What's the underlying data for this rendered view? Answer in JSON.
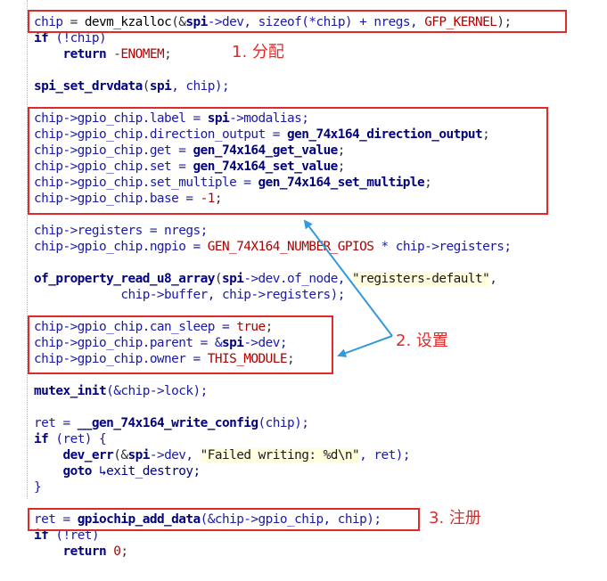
{
  "code_lines": [
    [
      {
        "t": "chip",
        "c": "var"
      },
      {
        "t": " = ",
        "c": "op"
      },
      {
        "t": "devm_kzalloc",
        "c": "plain"
      },
      {
        "t": "(&",
        "c": "op"
      },
      {
        "t": "spi",
        "c": "kw"
      },
      {
        "t": "->dev, sizeof(*chip) + nregs, ",
        "c": "var"
      },
      {
        "t": "GFP_KERNEL",
        "c": "macro"
      },
      {
        "t": ");",
        "c": "op"
      }
    ],
    [
      {
        "t": "if",
        "c": "kw"
      },
      {
        "t": " (!chip)",
        "c": "var"
      }
    ],
    [
      {
        "t": "    return",
        "c": "kw"
      },
      {
        "t": " -",
        "c": "op"
      },
      {
        "t": "ENOMEM",
        "c": "macro"
      },
      {
        "t": ";",
        "c": "op"
      }
    ],
    [],
    [
      {
        "t": "spi_set_drvdata",
        "c": "fn"
      },
      {
        "t": "(",
        "c": "op"
      },
      {
        "t": "spi",
        "c": "kw"
      },
      {
        "t": ", chip);",
        "c": "var"
      }
    ],
    [],
    [
      {
        "t": "chip->gpio_chip.label = ",
        "c": "var"
      },
      {
        "t": "spi",
        "c": "kw"
      },
      {
        "t": "->modalias;",
        "c": "var"
      }
    ],
    [
      {
        "t": "chip->gpio_chip.direction_output = ",
        "c": "var"
      },
      {
        "t": "gen_74x164_direction_output",
        "c": "fn"
      },
      {
        "t": ";",
        "c": "op"
      }
    ],
    [
      {
        "t": "chip->gpio_chip.get = ",
        "c": "var"
      },
      {
        "t": "gen_74x164_get_value",
        "c": "fn"
      },
      {
        "t": ";",
        "c": "op"
      }
    ],
    [
      {
        "t": "chip->gpio_chip.set = ",
        "c": "var"
      },
      {
        "t": "gen_74x164_set_value",
        "c": "fn"
      },
      {
        "t": ";",
        "c": "op"
      }
    ],
    [
      {
        "t": "chip->gpio_chip.set_multiple = ",
        "c": "var"
      },
      {
        "t": "gen_74x164_set_multiple",
        "c": "fn"
      },
      {
        "t": ";",
        "c": "op"
      }
    ],
    [
      {
        "t": "chip->gpio_chip.base = ",
        "c": "var"
      },
      {
        "t": "-1",
        "c": "num"
      },
      {
        "t": ";",
        "c": "op"
      }
    ],
    [],
    [
      {
        "t": "chip->registers = nregs;",
        "c": "var"
      }
    ],
    [
      {
        "t": "chip->gpio_chip.ngpio = ",
        "c": "var"
      },
      {
        "t": "GEN_74X164_NUMBER_GPIOS",
        "c": "macro"
      },
      {
        "t": " * chip->registers;",
        "c": "var"
      }
    ],
    [],
    [
      {
        "t": "of_property_read_u8_array",
        "c": "fn"
      },
      {
        "t": "(",
        "c": "op"
      },
      {
        "t": "spi",
        "c": "kw"
      },
      {
        "t": "->dev.of_node, ",
        "c": "var"
      },
      {
        "t": "\"registers-default\"",
        "c": "str"
      },
      {
        "t": ",",
        "c": "op"
      }
    ],
    [
      {
        "t": "            chip->buffer, chip->registers);",
        "c": "var"
      }
    ],
    [],
    [
      {
        "t": "chip->gpio_chip.can_sleep = ",
        "c": "var"
      },
      {
        "t": "true",
        "c": "bool"
      },
      {
        "t": ";",
        "c": "op"
      }
    ],
    [
      {
        "t": "chip->gpio_chip.parent = &",
        "c": "var"
      },
      {
        "t": "spi",
        "c": "kw"
      },
      {
        "t": "->dev;",
        "c": "var"
      }
    ],
    [
      {
        "t": "chip->gpio_chip.owner = ",
        "c": "var"
      },
      {
        "t": "THIS_MODULE",
        "c": "macro"
      },
      {
        "t": ";",
        "c": "op"
      }
    ],
    [],
    [
      {
        "t": "mutex_init",
        "c": "fn"
      },
      {
        "t": "(&chip->lock);",
        "c": "var"
      }
    ],
    [],
    [
      {
        "t": "ret = ",
        "c": "var"
      },
      {
        "t": "__gen_74x164_write_config",
        "c": "fn"
      },
      {
        "t": "(chip);",
        "c": "var"
      }
    ],
    [
      {
        "t": "if",
        "c": "kw"
      },
      {
        "t": " (ret) {",
        "c": "var"
      }
    ],
    [
      {
        "t": "    dev_err",
        "c": "fn"
      },
      {
        "t": "(&",
        "c": "op"
      },
      {
        "t": "spi",
        "c": "kw"
      },
      {
        "t": "->dev, ",
        "c": "var"
      },
      {
        "t": "\"Failed writing: %d\\n\"",
        "c": "str"
      },
      {
        "t": ", ret);",
        "c": "var"
      }
    ],
    [
      {
        "t": "    goto",
        "c": "kw"
      },
      {
        "t": " ↳exit_destroy;",
        "c": "label"
      }
    ],
    [
      {
        "t": "}",
        "c": "var"
      }
    ],
    [],
    [
      {
        "t": "ret = ",
        "c": "var"
      },
      {
        "t": "gpiochip_add_data",
        "c": "fn"
      },
      {
        "t": "(&chip->gpio_chip, chip);",
        "c": "var"
      }
    ],
    [
      {
        "t": "if",
        "c": "kw"
      },
      {
        "t": " (!ret)",
        "c": "var"
      }
    ],
    [
      {
        "t": "    return",
        "c": "kw"
      },
      {
        "t": " ",
        "c": "op"
      },
      {
        "t": "0",
        "c": "num"
      },
      {
        "t": ";",
        "c": "op"
      }
    ]
  ],
  "annotations": {
    "step1": "1. 分配",
    "step2": "2. 设置",
    "step3": "3. 注册"
  },
  "colors": {
    "highlight_red": "#e02a2a",
    "arrow_blue": "#3399dd"
  }
}
